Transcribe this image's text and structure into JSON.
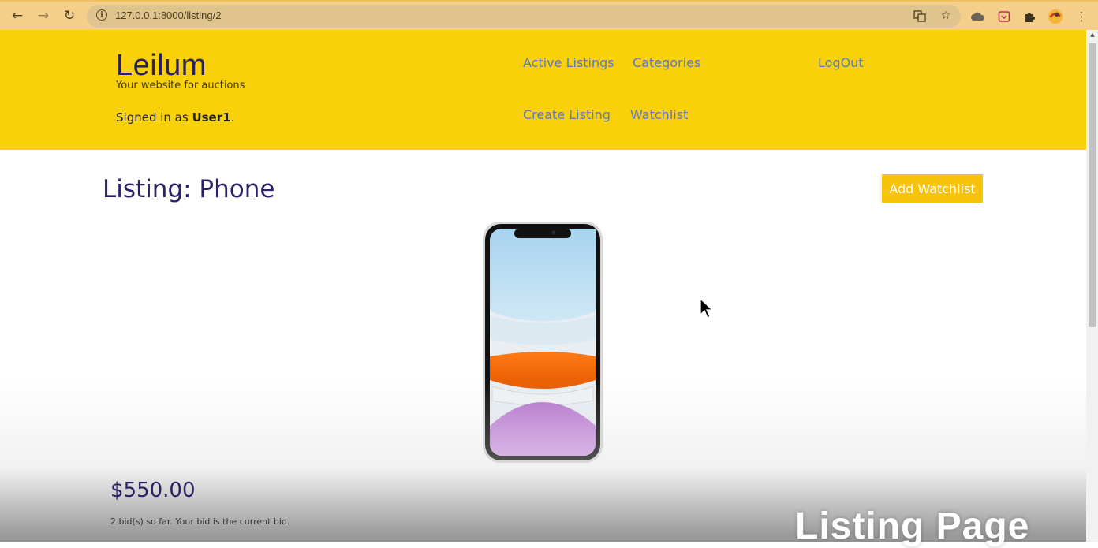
{
  "browser": {
    "url": "127.0.0.1:8000/listing/2",
    "icons": [
      "back-arrow-icon",
      "forward-arrow-icon",
      "reload-icon",
      "info-icon",
      "translate-icon",
      "star-icon",
      "cloud-icon",
      "pocket-icon",
      "puzzle-icon",
      "profile-avatar-icon",
      "menu-dots-icon"
    ]
  },
  "site": {
    "brand": "Leilum",
    "tagline": "Your website for auctions",
    "signed_prefix": "Signed in as ",
    "username": "User1",
    "signed_suffix": "."
  },
  "nav": {
    "active_listings": "Active Listings",
    "categories": "Categories",
    "logout": "LogOut",
    "create_listing": "Create Listing",
    "watchlist": "Watchlist"
  },
  "listing": {
    "title": "Listing: Phone",
    "add_watchlist": "Add Watchlist",
    "price": "$550.00",
    "bid_info": "2 bid(s) so far. Your bid is the current bid."
  },
  "overlay": {
    "watermark": "Listing Page"
  },
  "colors": {
    "header_bg": "#f9d10a",
    "brand_text": "#2b2266",
    "nav_link": "#5b78c7",
    "button_bg": "#f9c30c",
    "chrome_bg": "#f5ce89"
  }
}
